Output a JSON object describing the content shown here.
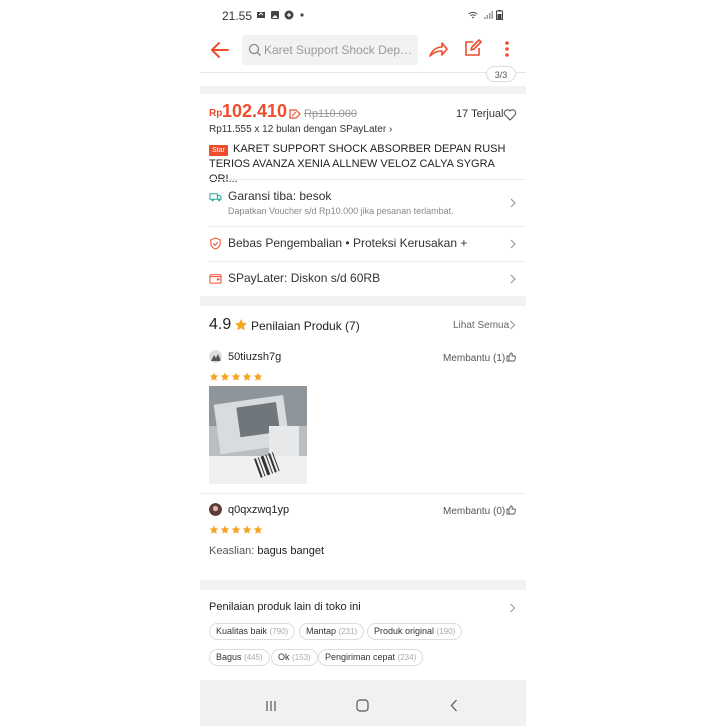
{
  "status_bar": {
    "time": "21.55"
  },
  "search": {
    "placeholder": "Karet Support Shock Depan ..."
  },
  "gallery": {
    "counter": "3/3"
  },
  "price": {
    "currency": "Rp",
    "value": "102.410",
    "original": "Rp110.000",
    "sold": "17 Terjual",
    "installment_prefix": "Rp11.555 x 12 bulan dengan ",
    "installment_brand": "SPayLater",
    "installment_suffix": " ›"
  },
  "product": {
    "badge": "Star",
    "title": "KARET SUPPORT SHOCK ABSORBER DEPAN RUSH TERIOS AVANZA XENIA ALLNEW VELOZ CALYA SYGRA ORI..."
  },
  "rows": {
    "garansi": {
      "label": "Garansi tiba: besok",
      "sub": "Dapatkan Voucher s/d Rp10.000 jika pesanan terlambat."
    },
    "pengembalian": {
      "label": "Bebas Pengembalian  •  Proteksi Kerusakan +"
    },
    "spaylater": {
      "label": "SPayLater: Diskon s/d 60RB"
    }
  },
  "ratings": {
    "score": "4.9",
    "label": "Penilaian Produk (7)",
    "see_all": "Lihat Semua",
    "reviews": [
      {
        "user": "50tiuzsh7g",
        "helpful": "Membantu (1)",
        "stars": 5
      },
      {
        "user": "q0qxzwq1yp",
        "helpful": "Membantu (0)",
        "stars": 5,
        "text_label": "Keaslian:",
        "text_value": "bagus banget"
      }
    ]
  },
  "shop_ratings": {
    "title": "Penilaian produk lain di toko ini",
    "chips": [
      {
        "label": "Kualitas baik",
        "count": "(790)"
      },
      {
        "label": "Mantap",
        "count": "(231)"
      },
      {
        "label": "Produk original",
        "count": "(190)"
      },
      {
        "label": "Bagus",
        "count": "(445)"
      },
      {
        "label": "Ok",
        "count": "(153)"
      },
      {
        "label": "Pengiriman cepat",
        "count": "(234)"
      }
    ]
  },
  "colors": {
    "accent": "#ee4d2d",
    "star": "#f5a623"
  },
  "icons": {
    "back": "arrow-left-icon",
    "search": "search-icon",
    "share": "share-icon",
    "edit": "edit-icon",
    "more": "more-vertical-icon",
    "heart": "heart-icon",
    "truck": "truck-icon",
    "shield": "shield-icon",
    "wallet": "wallet-icon",
    "star": "star-icon",
    "thumb": "thumbs-up-icon"
  }
}
